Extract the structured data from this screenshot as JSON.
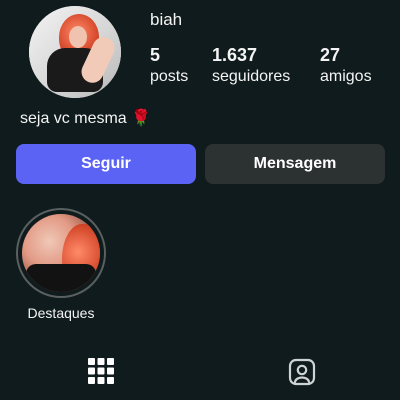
{
  "profile": {
    "username": "biah",
    "bio": "seja vc mesma",
    "bio_emoji": "🌹",
    "avatar": {
      "icon": "profile-avatar"
    }
  },
  "stats": [
    {
      "value": "5",
      "label": "posts"
    },
    {
      "value": "1.637",
      "label": "seguidores"
    },
    {
      "value": "27",
      "label": "amigos"
    }
  ],
  "buttons": {
    "follow": "Seguir",
    "message": "Mensagem"
  },
  "highlights": [
    {
      "label": "Destaques"
    }
  ],
  "tabs": [
    {
      "icon": "grid-icon"
    },
    {
      "icon": "tagged-icon"
    }
  ],
  "colors": {
    "background": "#0f1b1c",
    "follow_button": "#5b63f5",
    "message_button": "#2c3132",
    "text": "#f4f4f4"
  }
}
